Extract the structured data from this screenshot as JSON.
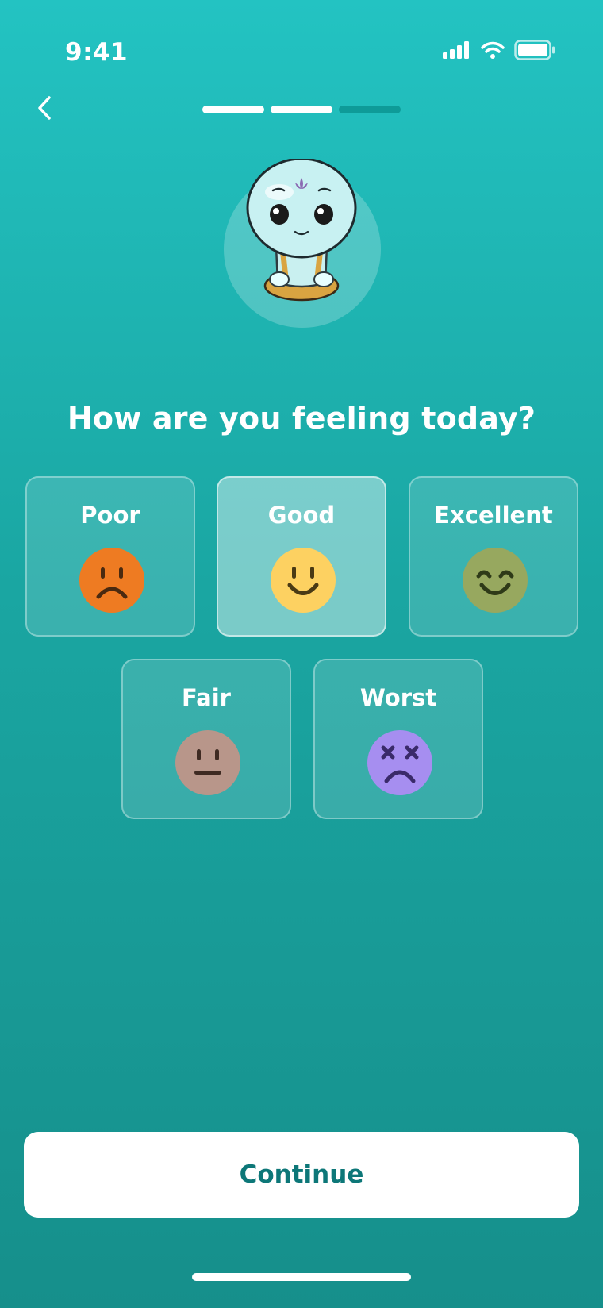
{
  "status_bar": {
    "time": "9:41",
    "icons": [
      "signal-icon",
      "wifi-icon",
      "battery-icon"
    ]
  },
  "header": {
    "back_icon": "chevron-left-icon",
    "progress_steps_done": 2,
    "progress_steps_total": 3
  },
  "mascot": {
    "icon": "meditating-mascot-icon"
  },
  "question": "How are you feeling today?",
  "moods": [
    {
      "label": "Poor",
      "face": "sad-face-icon",
      "color": "#ee7b22",
      "selected": false
    },
    {
      "label": "Good",
      "face": "smile-face-icon",
      "color": "#fdd161",
      "selected": true
    },
    {
      "label": "Excellent",
      "face": "happy-face-icon",
      "color": "#97a85f",
      "selected": false
    },
    {
      "label": "Fair",
      "face": "neutral-face-icon",
      "color": "#b8968a",
      "selected": false
    },
    {
      "label": "Worst",
      "face": "dizzy-face-icon",
      "color": "#a68ef0",
      "selected": false
    }
  ],
  "colors": {
    "accent": "#0d7778",
    "background_top": "#23c3c2",
    "background_bottom": "#168f8b"
  },
  "continue_label": "Continue"
}
